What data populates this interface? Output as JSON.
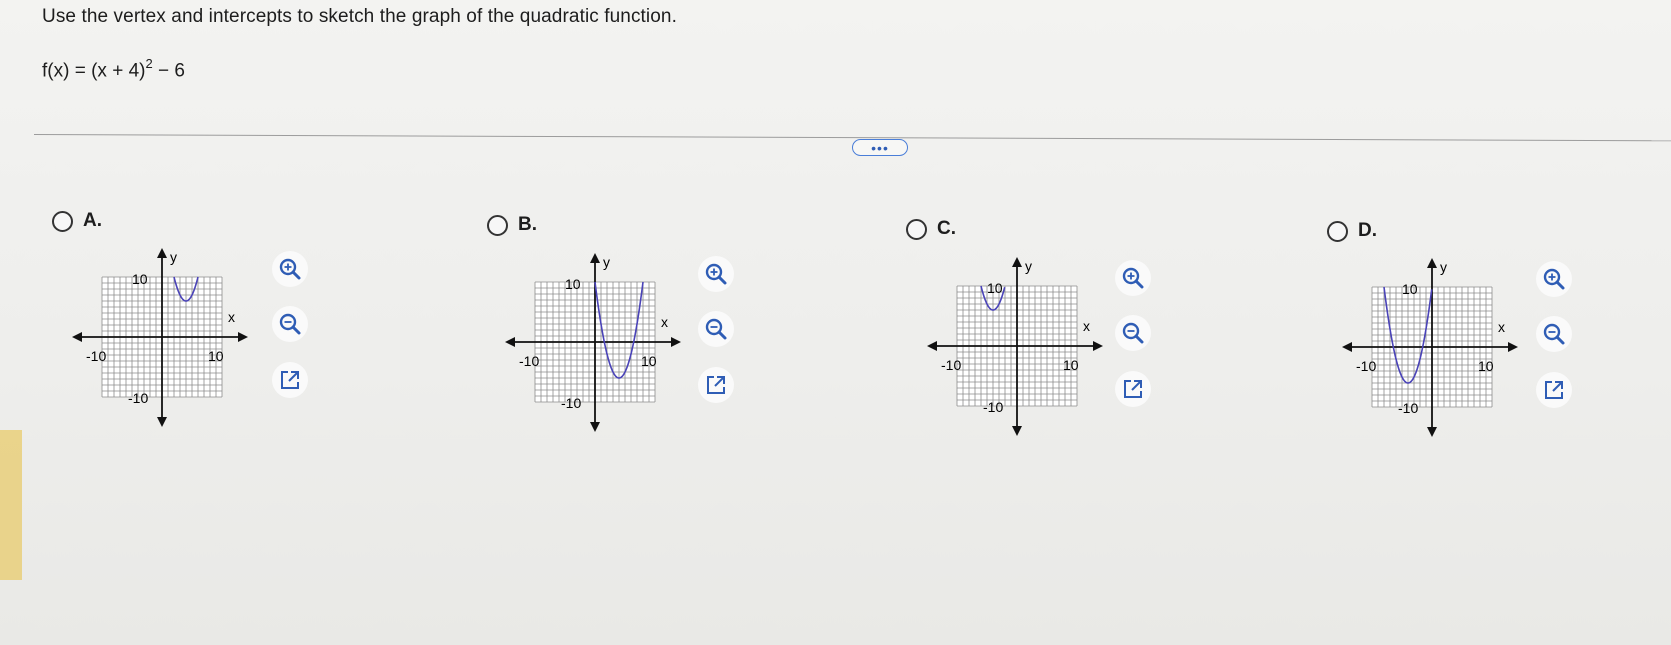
{
  "question": {
    "prompt": "Use the vertex and intercepts to sketch the graph of the quadratic function.",
    "function_prefix": "f(x) = (x + 4)",
    "function_exponent": "2",
    "function_suffix": " − 6"
  },
  "more_button_label": "•••",
  "options": [
    {
      "letter": "A.",
      "x_label": "x",
      "y_label": "y",
      "tick_neg_x": "-10",
      "tick_pos_x": "10",
      "tick_pos_y": "10",
      "tick_neg_y": "-10",
      "vertex": [
        4,
        6
      ]
    },
    {
      "letter": "B.",
      "x_label": "x",
      "y_label": "y",
      "tick_neg_x": "-10",
      "tick_pos_x": "10",
      "tick_pos_y": "10",
      "tick_neg_y": "-10",
      "vertex": [
        4,
        -6
      ]
    },
    {
      "letter": "C.",
      "x_label": "x",
      "y_label": "y",
      "tick_neg_x": "-10",
      "tick_pos_x": "10",
      "tick_pos_y": "10",
      "tick_neg_y": "-10",
      "vertex": [
        -4,
        6
      ]
    },
    {
      "letter": "D.",
      "x_label": "x",
      "y_label": "y",
      "tick_neg_x": "-10",
      "tick_pos_x": "10",
      "tick_pos_y": "10",
      "tick_neg_y": "-10",
      "vertex": [
        -4,
        -6
      ]
    }
  ],
  "tools": [
    "zoom-in-icon",
    "zoom-out-icon",
    "open-external-icon"
  ],
  "colors": {
    "curve": "#4a43b8",
    "grid": "#8c8c8c",
    "link": "#2f5db5"
  }
}
